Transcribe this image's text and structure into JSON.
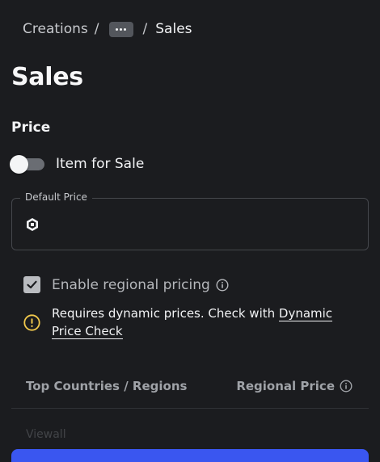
{
  "breadcrumb": {
    "root": "Creations",
    "separator": "/",
    "more_icon": "ellipsis-icon",
    "current": "Sales"
  },
  "page": {
    "title": "Sales"
  },
  "price_section": {
    "title": "Price",
    "toggle": {
      "label": "Item for Sale",
      "on": false
    },
    "default_price": {
      "label": "Default Price",
      "value": "",
      "placeholder": "",
      "currency_icon": "robux-icon"
    }
  },
  "regional": {
    "checkbox_label": "Enable regional pricing",
    "checked": true,
    "warning_text": "Requires dynamic prices. Check with ",
    "warning_link": "Dynamic Price Check"
  },
  "table": {
    "columns": [
      "Top Countries / Regions",
      "Regional Price"
    ],
    "partial_row": "Viewall"
  },
  "colors": {
    "background": "#1b1c1f",
    "accent": "#3a56f0",
    "warning": "#f2c94c"
  }
}
